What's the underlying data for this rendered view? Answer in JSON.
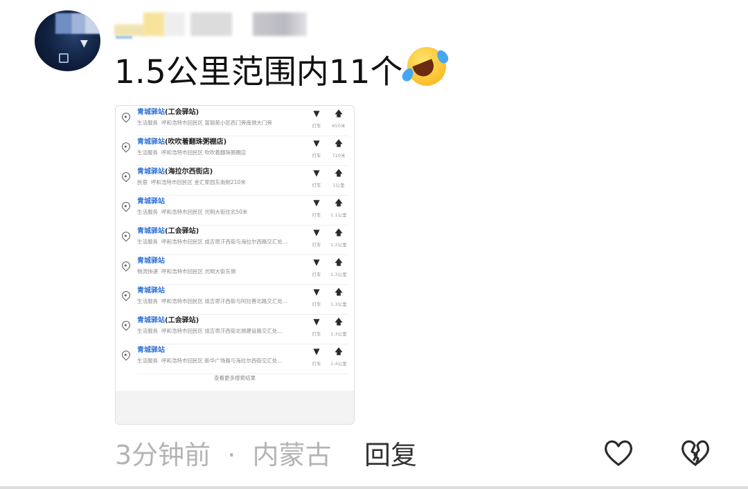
{
  "comment": {
    "text": "1.5公里范围内11个",
    "emoji": "laughing-crying-face",
    "time": "3分钟前",
    "separator": "·",
    "location": "内蒙古",
    "reply_label": "回复"
  },
  "screenshot": {
    "results": [
      {
        "brand": "青城驿站",
        "branch": "(工会驿站)",
        "category": "生活服务",
        "address": "呼和浩特市回民区 富丽苑小区西门旁南侧大门旁",
        "taxi_label": "打车",
        "distance": "650米"
      },
      {
        "brand": "青城驿站",
        "branch": "(吹吹着翻珠粥棚店)",
        "category": "生活服务",
        "address": "呼和浩特市回民区 吹吹着翻珠粥棚店",
        "taxi_label": "打车",
        "distance": "710米"
      },
      {
        "brand": "青城驿站",
        "branch": "(海拉尔西街店)",
        "category": "民宿",
        "address": "呼和浩特市回民区 金汇家园东南侧210米",
        "taxi_label": "打车",
        "distance": "1公里"
      },
      {
        "brand": "青城驿站",
        "branch": "",
        "category": "生活服务",
        "address": "呼和浩特市回民区 光明大街往北50米",
        "taxi_label": "打车",
        "distance": "1.1公里"
      },
      {
        "brand": "青城驿站",
        "branch": "(工会驿站)",
        "category": "生活服务",
        "address": "呼和浩特市回民区 成吉思汗西街与海拉尔西路交汇处...",
        "taxi_label": "打车",
        "distance": "1.2公里"
      },
      {
        "brand": "青城驿站",
        "branch": "",
        "category": "物流快递",
        "address": "呼和浩特市回民区 光明大街东侧",
        "taxi_label": "打车",
        "distance": "1.3公里"
      },
      {
        "brand": "青城驿站",
        "branch": "",
        "category": "生活服务",
        "address": "呼和浩特市回民区 成吉思汗西街与阿拉善北路交汇处...",
        "taxi_label": "打车",
        "distance": "1.3公里"
      },
      {
        "brand": "青城驿站",
        "branch": "(工会驿站)",
        "category": "生活服务",
        "address": "呼和浩特市回民区 成吉思汗西街北侧建设路交汇处...",
        "taxi_label": "打车",
        "distance": "1.3公里"
      },
      {
        "brand": "青城驿站",
        "branch": "",
        "category": "生活服务",
        "address": "呼和浩特市回民区 新华广场路与海拉尔西街交汇处...",
        "taxi_label": "打车",
        "distance": "1.4公里"
      }
    ],
    "more_label": "查看更多搜索结果"
  }
}
